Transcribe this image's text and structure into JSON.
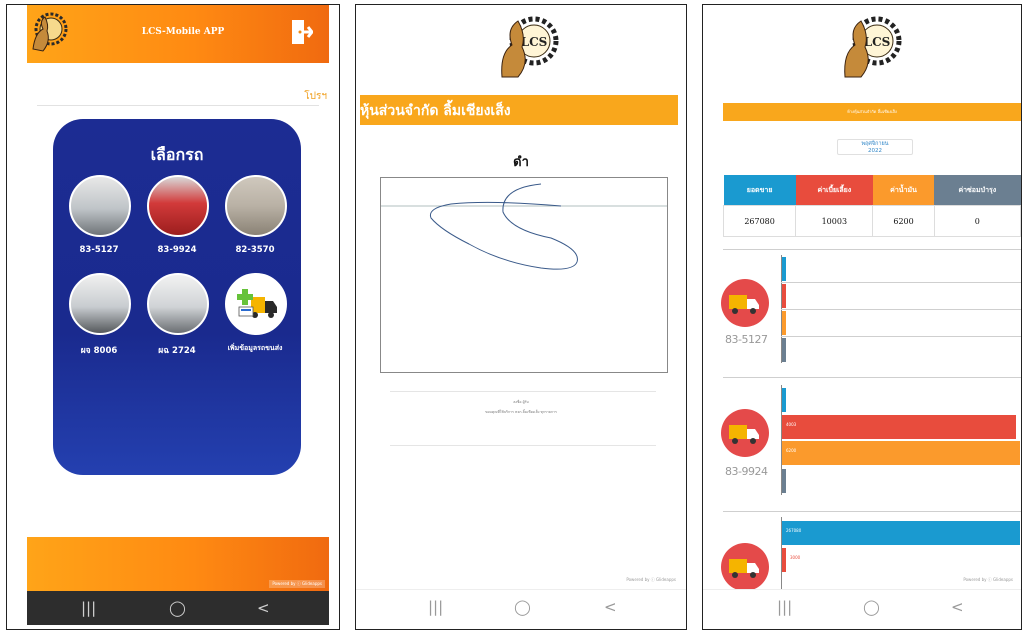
{
  "phone1": {
    "app_title": "LCS-Mobile APP",
    "logo_text": "LCS",
    "top_link": "โปรฯ",
    "card_title": "เลือกรถ",
    "trucks": [
      {
        "label": "83-5127"
      },
      {
        "label": "83-9924"
      },
      {
        "label": "82-3570"
      },
      {
        "label": "ผจ 8006"
      },
      {
        "label": "ผฉ 2724"
      },
      {
        "label": "เพิ่มข้อมูลรถขนส่ง"
      }
    ],
    "powered_by": "Powered by ⓘ Glideapps",
    "nav": [
      "|||",
      "◯",
      "<"
    ]
  },
  "phone2": {
    "logo_text": "LCS",
    "company_name": "หุ้นส่วนจำกัด ลิ้มเชียงเส็ง",
    "signature_label": "ดำ",
    "fine_text_1": "ลงชื่อ ผู้รับ",
    "fine_text_2": "ขอบคุณที่ใช้บริการ หจก.ลิ้มเชียงเส็ง ทุกรายการ",
    "powered_by": "Powered by ⓘ Glideapps",
    "nav": [
      "|||",
      "◯",
      "<"
    ]
  },
  "phone3": {
    "logo_text": "LCS",
    "banner_text": "ห้างหุ้นส่วนจำกัด ลิ้มเชียงเส็ง",
    "date_month": "พฤศจิกายน",
    "date_year": "2022",
    "table": {
      "headers": [
        "ยอดขาย",
        "ค่าเบี้ยเลี้ยง",
        "ค่าน้ำมัน",
        "ค่าซ่อมบำรุง"
      ],
      "values": [
        "267080",
        "10003",
        "6200",
        "0"
      ]
    },
    "vehicles": [
      {
        "plate": "83-5127",
        "bars": [
          {
            "value": "0"
          },
          {
            "value": "0"
          },
          {
            "value": "0"
          },
          {
            "value": "0"
          }
        ]
      },
      {
        "plate": "83-9924",
        "bars": [
          {
            "value": "0"
          },
          {
            "value": "4003"
          },
          {
            "value": "6200"
          },
          {
            "value": "0"
          }
        ]
      },
      {
        "plate": "",
        "bars": [
          {
            "value": "267080"
          },
          {
            "value": "3000"
          }
        ]
      }
    ],
    "powered_by": "Powered by ⓘ Glideapps",
    "nav": [
      "|||",
      "◯",
      "<"
    ]
  },
  "colors": {
    "orange": "#f9a71c",
    "header_gradient_end": "#f06a10",
    "navy": "#1c2c93",
    "blue": "#1a9ad0",
    "red": "#e84c3d",
    "orange_header": "#fb9a2c",
    "grey_header": "#6b7f91"
  }
}
